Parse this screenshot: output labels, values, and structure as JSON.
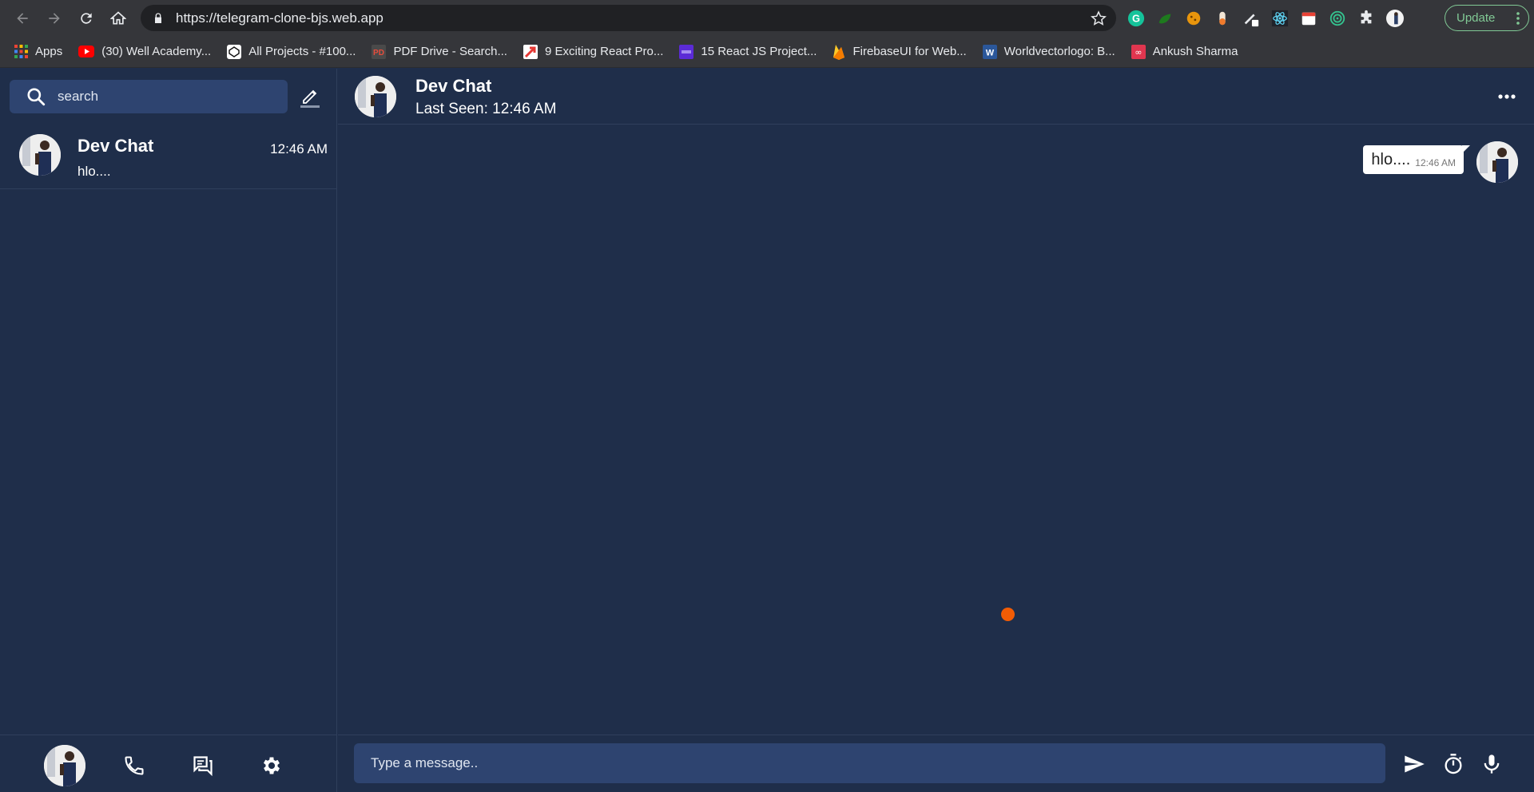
{
  "browser": {
    "url": "https://telegram-clone-bjs.web.app",
    "update_label": "Update",
    "bookmarks": [
      {
        "label": "Apps",
        "icon": "apps-grid-icon",
        "color": "#e8453c"
      },
      {
        "label": "(30) Well Academy...",
        "icon": "youtube-icon",
        "color": "#ff0000"
      },
      {
        "label": "All Projects - #100...",
        "icon": "codepen-icon",
        "color": "#ffffff"
      },
      {
        "label": "PDF Drive - Search...",
        "icon": "pdf-drive-icon",
        "color": "#c0392b"
      },
      {
        "label": "9 Exciting React Pro...",
        "icon": "bookmark-red-icon",
        "color": "#e53935"
      },
      {
        "label": "15 React JS Project...",
        "icon": "bookmark-purple-icon",
        "color": "#5b2bd6"
      },
      {
        "label": "FirebaseUI for Web...",
        "icon": "firebase-icon",
        "color": "#ffca28"
      },
      {
        "label": "Worldvectorlogo: B...",
        "icon": "word-icon",
        "color": "#2b579a"
      },
      {
        "label": "Ankush Sharma",
        "icon": "link-icon",
        "color": "#e0364f"
      }
    ]
  },
  "sidebar": {
    "search_placeholder": "search",
    "chats": [
      {
        "name": "Dev Chat",
        "time": "12:46 AM",
        "preview": "hlo...."
      }
    ]
  },
  "chat": {
    "title": "Dev Chat",
    "status": "Last Seen: 12:46 AM",
    "messages": [
      {
        "text": "hlo....",
        "time": "12:46 AM"
      }
    ],
    "composer_placeholder": "Type a message.."
  },
  "colors": {
    "background": "#1f2e4a",
    "input_bg": "#2e4470",
    "cursor_dot": "#f25c05"
  }
}
